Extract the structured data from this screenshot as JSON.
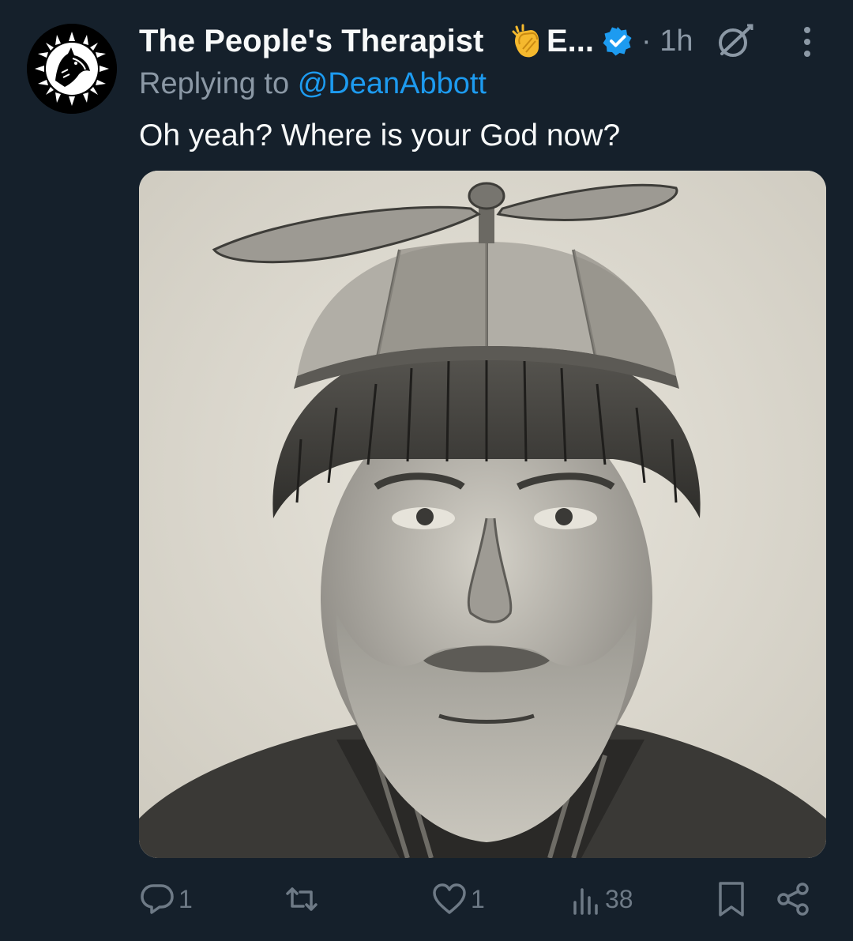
{
  "author": {
    "display_name": "The People's Therapist",
    "name_truncation": "E...",
    "clap_emoji": "👏",
    "verified": true,
    "avatar_icon": "wolf-sun-logo-icon"
  },
  "meta": {
    "timestamp": "· 1h",
    "grok_icon": "grok-icon",
    "more_icon": "more-vertical-icon"
  },
  "reply": {
    "prefix": "Replying to",
    "mention": "@DeanAbbott"
  },
  "body": {
    "text": "Oh yeah? Where is your God now?"
  },
  "media": {
    "image_description_icon": "pencil-drawing-man-propeller-beanie"
  },
  "actions": {
    "reply_count": "1",
    "like_count": "1",
    "views_count": "38"
  },
  "colors": {
    "background": "#15202b",
    "text_primary": "#f7f9f9",
    "text_secondary": "#8b98a5",
    "accent": "#1d9bf0",
    "action_icon": "#6e7a86"
  }
}
